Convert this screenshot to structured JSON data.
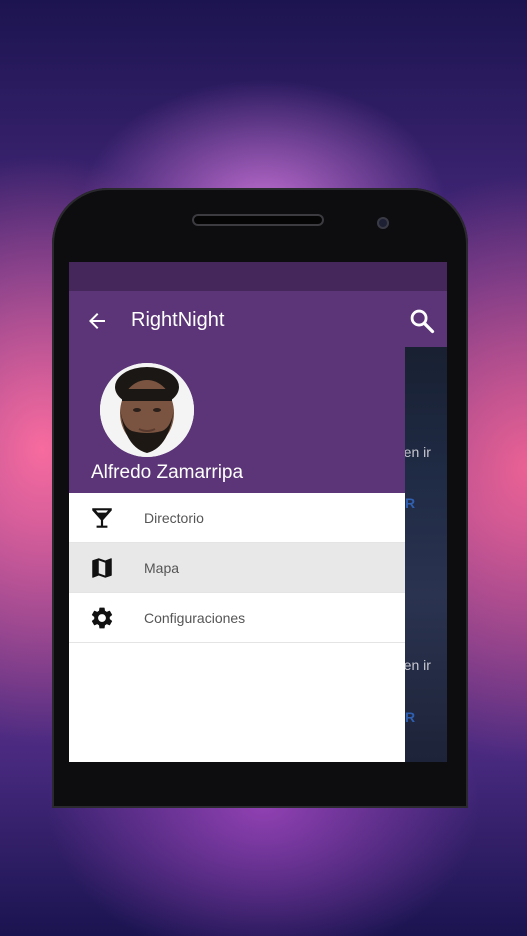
{
  "app_bar": {
    "title": "RightNight",
    "back_icon": "arrow-back-icon",
    "search_icon": "search-icon"
  },
  "drawer": {
    "user_name": "Alfredo Zamarripa",
    "items": [
      {
        "label": "Directorio",
        "icon": "cocktail-icon",
        "selected": false
      },
      {
        "label": "Mapa",
        "icon": "map-icon",
        "selected": true
      },
      {
        "label": "Configuraciones",
        "icon": "settings-icon",
        "selected": false
      }
    ]
  },
  "background_content": {
    "snippet_1": "ren ir",
    "snippet_2": "ren ir",
    "button_fragment_1": "R",
    "button_fragment_2": "R"
  },
  "colors": {
    "app_bar": "#5b3577",
    "status_bar": "#45275c",
    "selected_item": "#e8e8e8"
  }
}
